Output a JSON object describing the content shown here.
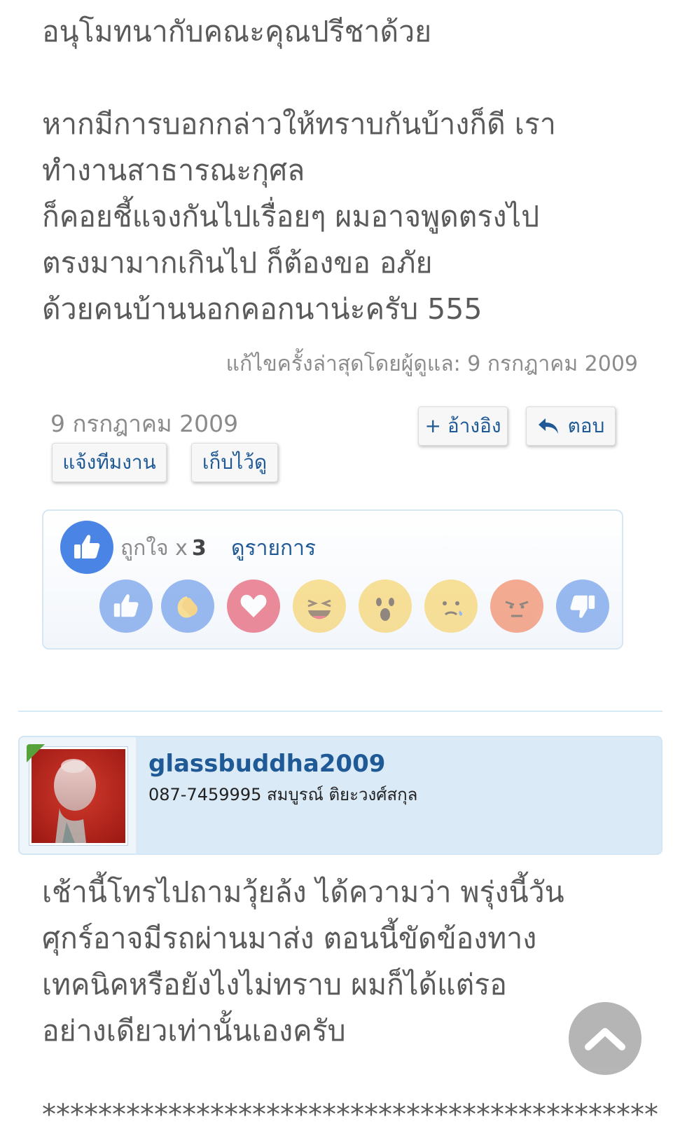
{
  "post_top": {
    "text": "อนุโมทนากับคณะคุณปรีชาด้วย\n\nหากมีการบอกกล่าวให้ทราบกันบ้างก็ดี เรา\nทำงานสาธารณะกุศล\nก็คอยชี้แจงกันไปเรื่อยๆ ผมอาจพูดตรงไป\nตรงมามากเกินไป ก็ต้องขอ อภัย\nด้วยคนบ้านนอกคอกนาน่ะครับ 555",
    "edit_note": "แก้ไขครั้งล่าสุดโดยผู้ดูแล: 9 กรกฎาคม 2009",
    "date": "9 กรกฎาคม 2009",
    "buttons": {
      "report": "แจ้งทีมงาน",
      "bookmark": "เก็บไว้ดู",
      "quote": "+ อ้างอิง",
      "reply": "ตอบ"
    }
  },
  "reactions": {
    "like_label": "ถูกใจ x",
    "like_count": "3",
    "view_list": "ดูรายการ",
    "icons": [
      "like-icon",
      "clap-icon",
      "heart-icon",
      "laugh-icon",
      "wow-icon",
      "sad-icon",
      "angry-icon",
      "dislike-icon"
    ]
  },
  "user": {
    "username": "glassbuddha2009",
    "title": "087-7459995 สมบูรณ์ ติยะวงศ์สกุล"
  },
  "post_bottom": {
    "text": "เช้านี้โทรไปถามวุ้ยล้ง ได้ความว่า พรุ่งนี้วัน\nศุกร์อาจมีรถผ่านมาส่ง ตอนนี้ขัดข้องทาง\nเทคนิคหรือยังไงไม่ทราบ ผมก็ได้แต่รอ\nอย่างเดียวเท่านั้นเองครับ",
    "separator": "****************************************************"
  },
  "colors": {
    "accent": "#1f5a96",
    "like_blue": "#4a84e4",
    "card_bg": "#dbeaf7"
  }
}
